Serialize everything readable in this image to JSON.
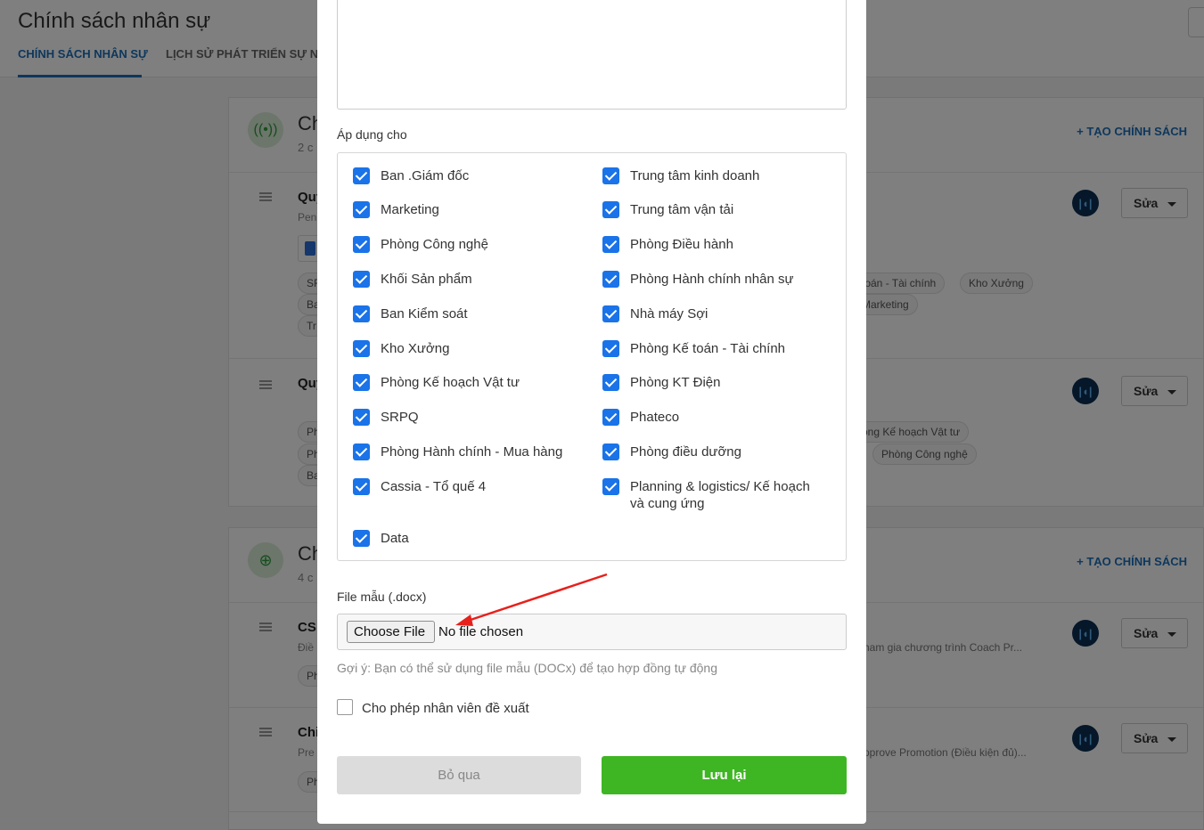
{
  "page": {
    "title": "Chính sách nhân sự",
    "tabs": [
      {
        "label": "CHÍNH SÁCH NHÂN SỰ",
        "active": true
      },
      {
        "label": "LỊCH SỬ PHÁT TRIỂN SỰ NG",
        "active": false
      }
    ],
    "sections": [
      {
        "title_prefix": "Ch",
        "subtitle_prefix": "2 c",
        "create_label": "+ TẠO CHÍNH SÁCH",
        "rows": [
          {
            "title": "Quy",
            "subtitle": "Pen",
            "chips_left": [
              "SF",
              "Ba",
              "Tr"
            ],
            "chips_right": [
              "toán - Tài chính",
              "Kho Xưởng",
              "Marketing"
            ],
            "edit_label": "Sửa"
          },
          {
            "title": "Quy",
            "chips_left": [
              "Ph",
              "Ph",
              "Ba"
            ],
            "chips_right": [
              "òng Kế hoạch Vật tư",
              "Phòng Công nghệ"
            ],
            "edit_label": "Sửa"
          }
        ]
      },
      {
        "title_prefix": "Ch",
        "subtitle_prefix": "4 c",
        "create_label": "+ TẠO CHÍNH SÁCH",
        "rows": [
          {
            "title": "CS",
            "subtitle": "Điề",
            "chips_left": [
              "Ph"
            ],
            "desc": "ham gia chương trình Coach Pr...",
            "edit_label": "Sửa"
          },
          {
            "title": "Chi",
            "subtitle": "Pre",
            "chips_left": [
              "Ph"
            ],
            "desc": "pprove Promotion (Điều kiện đủ)...",
            "edit_label": "Sửa"
          }
        ]
      }
    ]
  },
  "modal": {
    "apply_label": "Áp dụng cho",
    "departments_left": [
      "Ban .Giám đốc",
      "Marketing",
      "Phòng Công nghệ",
      "Khối Sản phẩm",
      "Ban Kiểm soát",
      "Kho Xưởng",
      "Phòng Kế hoạch Vật tư",
      "SRPQ",
      "Phòng Hành chính - Mua hàng",
      "Cassia - Tổ quế 4",
      "Data"
    ],
    "departments_right": [
      "Trung tâm kinh doanh",
      "Trung tâm vận tải",
      "Phòng Điều hành",
      "Phòng Hành chính nhân sự",
      "Nhà máy Sợi",
      "Phòng Kế toán - Tài chính",
      "Phòng KT Điện",
      "Phateco",
      "Phòng điều dưỡng",
      "Planning & logistics/ Kế hoạch và cung ứng"
    ],
    "file_label": "File mẫu (.docx)",
    "choose_file_label": "Choose File",
    "no_file_text": "No file chosen",
    "hint": "Gợi ý: Bạn có thể sử dụng file mẫu (DOCx) để tạo hợp đồng tự động",
    "allow_label": "Cho phép nhân viên đề xuất",
    "cancel_label": "Bỏ qua",
    "save_label": "Lưu lại"
  },
  "colors": {
    "accent": "#1d6fb8",
    "checkbox": "#1a73e8",
    "save": "#3eb623",
    "annotation_arrow": "#e8201c"
  },
  "icons": [
    "broadcast-icon",
    "arrow-up-circle-icon",
    "drag-handle-icon",
    "docx-file-icon",
    "caret-down-icon",
    "status-icon",
    "checkmark-icon",
    "red-arrow-annotation"
  ]
}
